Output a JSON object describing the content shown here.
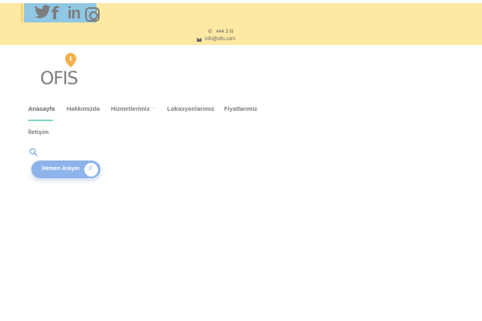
{
  "topbar": {
    "social": [
      {
        "name": "twitter-icon"
      },
      {
        "name": "facebook-icon",
        "glyph": "f"
      },
      {
        "name": "linkedin-icon",
        "glyph": "in"
      },
      {
        "name": "instagram-icon"
      }
    ],
    "phone": "444 3 fit",
    "email": "info@ofis.com"
  },
  "logo": {
    "text": "OFIS",
    "pin_color": "#f3b14a"
  },
  "nav": {
    "items": [
      {
        "label": "Anasayfa",
        "active": true
      },
      {
        "label": "Hakkımızda"
      },
      {
        "label": "Hizmetlerimiz",
        "has_dropdown": true
      },
      {
        "label": "Lokasyonlarımız"
      },
      {
        "label": "Fiyatlarımız"
      },
      {
        "label": "İletişim"
      }
    ]
  },
  "search": {
    "icon": "search-icon"
  },
  "cta": {
    "label": "Hemen Arayın",
    "icon": "phone-icon"
  },
  "colors": {
    "topbar_bg": "#fde9a3",
    "accent_underline": "#7fd6c5",
    "cta_bg": "#8db4ea"
  }
}
